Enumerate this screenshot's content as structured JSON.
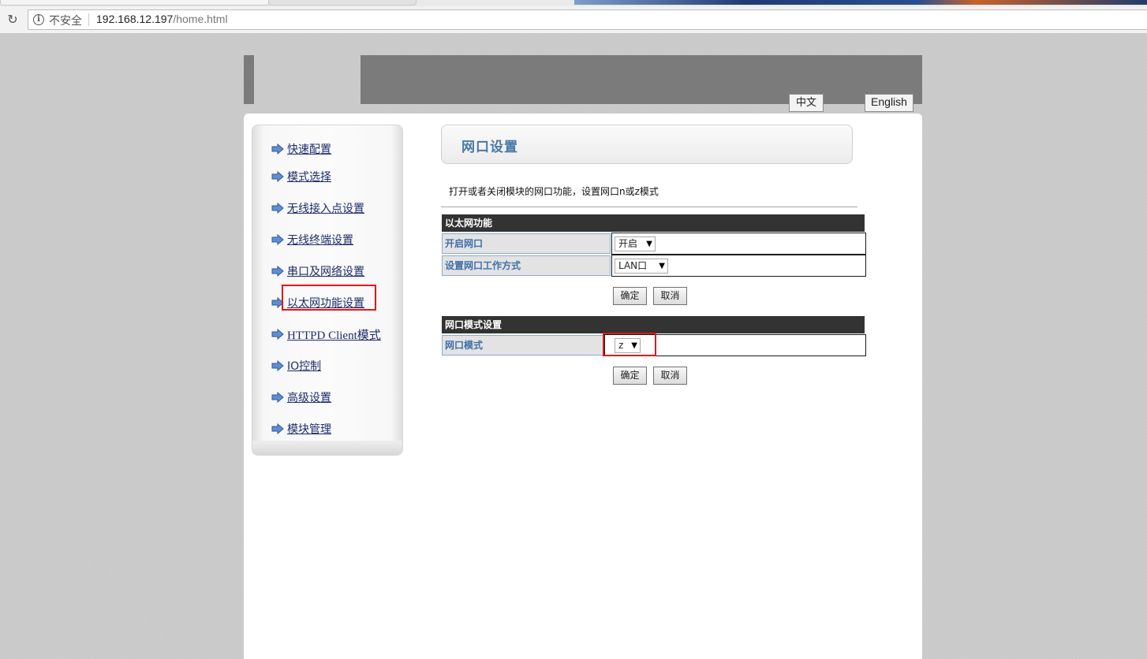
{
  "browser": {
    "security_label": "不安全",
    "url_host": "192.168.12.197",
    "url_path": "/home.html"
  },
  "header": {
    "lang_zh": "中文",
    "lang_en": "English"
  },
  "sidebar": {
    "items": [
      {
        "label": "快速配置"
      },
      {
        "label": "模式选择"
      },
      {
        "label": "无线接入点设置"
      },
      {
        "label": "无线终端设置"
      },
      {
        "label": "串口及网络设置"
      },
      {
        "label": "以太网功能设置",
        "selected": true
      },
      {
        "label": "HTTPD Client模式"
      },
      {
        "label": "IO控制"
      },
      {
        "label": "高级设置"
      },
      {
        "label": "模块管理"
      }
    ]
  },
  "main": {
    "title": "网口设置",
    "description": "打开或者关闭模块的网口功能，设置网口n或z模式",
    "ethernet_section": {
      "heading": "以太网功能",
      "rows": [
        {
          "label": "开启网口",
          "value": "开启"
        },
        {
          "label": "设置网口工作方式",
          "value": "LAN口"
        }
      ],
      "confirm": "确定",
      "cancel": "取消"
    },
    "mode_section": {
      "heading": "网口模式设置",
      "rows": [
        {
          "label": "网口模式",
          "value": "z"
        }
      ],
      "confirm": "确定",
      "cancel": "取消"
    }
  },
  "colors": {
    "highlight": "#e01818",
    "link": "#1f2d6b",
    "label_blue": "#3f6fa8"
  }
}
